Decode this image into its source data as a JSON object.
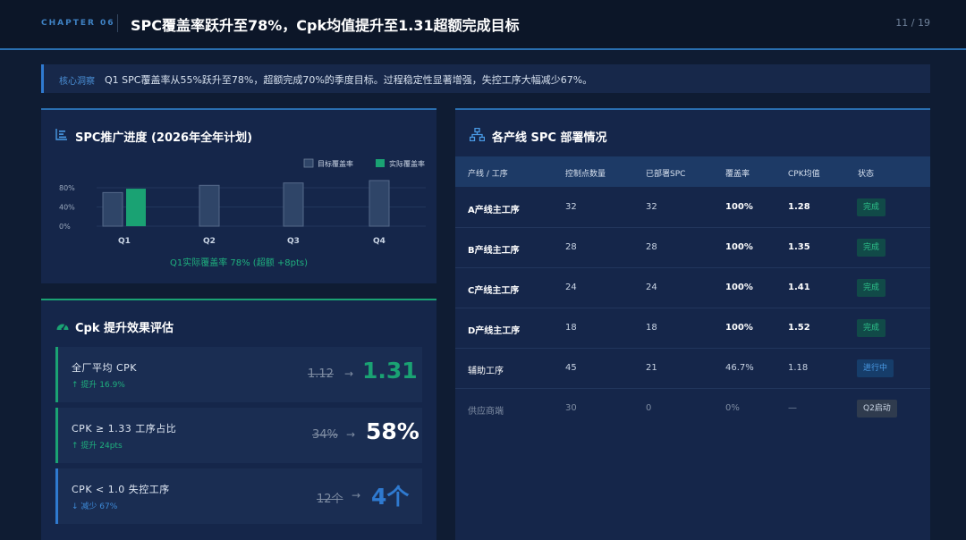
{
  "header": {
    "chapter": "CHAPTER 06",
    "title": "SPC覆盖率跃升至78%，Cpk均值提升至1.31超额完成目标",
    "page": "11 / 19"
  },
  "insight": {
    "tag": "核心洞察",
    "text": "Q1 SPC覆盖率从55%跃升至78%，超额完成70%的季度目标。过程稳定性显著增强，失控工序大幅减少67%。"
  },
  "progress_card": {
    "title": "SPC推广进度 (2026年全年计划)",
    "icon": "bar-chart-icon",
    "footnote": "Q1实际覆盖率 78% (超额 +8pts)"
  },
  "chart_data": {
    "type": "bar",
    "categories": [
      "Q1",
      "Q2",
      "Q3",
      "Q4"
    ],
    "series": [
      {
        "name": "目标覆盖率",
        "values": [
          70,
          85,
          90,
          95
        ],
        "color": "#2f4568"
      },
      {
        "name": "实际覆盖率",
        "values": [
          78,
          null,
          null,
          null
        ],
        "color": "#1aa273"
      }
    ],
    "yticks": [
      "80%",
      "40%",
      "0%"
    ],
    "ylim": [
      0,
      100
    ],
    "grid": true,
    "legend": "top-right"
  },
  "cpk_card": {
    "title": "Cpk 提升效果评估",
    "icon": "gauge-icon",
    "items": [
      {
        "label": "全厂平均 CPK",
        "delta": "↑ 提升 16.9%",
        "old": "1.12",
        "arrow": "→",
        "new": "1.31",
        "color": "#1aa273"
      },
      {
        "label": "CPK ≥ 1.33 工序占比",
        "delta": "↑ 提升 24pts",
        "old": "34%",
        "arrow": "→",
        "new": "58%",
        "color": "#ffffff"
      },
      {
        "label": "CPK < 1.0 失控工序",
        "delta": "↓ 减少 67%",
        "old": "12个",
        "arrow": "→",
        "new": "4个",
        "color": "#2f7ad0"
      }
    ]
  },
  "table_card": {
    "title": "各产线 SPC 部署情况",
    "icon": "network-icon",
    "columns": [
      "产线 / 工序",
      "控制点数量",
      "已部署SPC",
      "覆盖率",
      "CPK均值",
      "状态"
    ],
    "rows": [
      {
        "line": "A产线主工序",
        "points": "32",
        "deployed": "32",
        "coverage": "100%",
        "cpk": "1.28",
        "status": "完成",
        "kind": "done"
      },
      {
        "line": "B产线主工序",
        "points": "28",
        "deployed": "28",
        "coverage": "100%",
        "cpk": "1.35",
        "status": "完成",
        "kind": "done"
      },
      {
        "line": "C产线主工序",
        "points": "24",
        "deployed": "24",
        "coverage": "100%",
        "cpk": "1.41",
        "status": "完成",
        "kind": "done"
      },
      {
        "line": "D产线主工序",
        "points": "18",
        "deployed": "18",
        "coverage": "100%",
        "cpk": "1.52",
        "status": "完成",
        "kind": "done"
      },
      {
        "line": "辅助工序",
        "points": "45",
        "deployed": "21",
        "coverage": "46.7%",
        "cpk": "1.18",
        "status": "进行中",
        "kind": "prog"
      },
      {
        "line": "供应商端",
        "points": "30",
        "deployed": "0",
        "coverage": "0%",
        "cpk": "—",
        "status": "Q2启动",
        "kind": "next"
      }
    ]
  }
}
